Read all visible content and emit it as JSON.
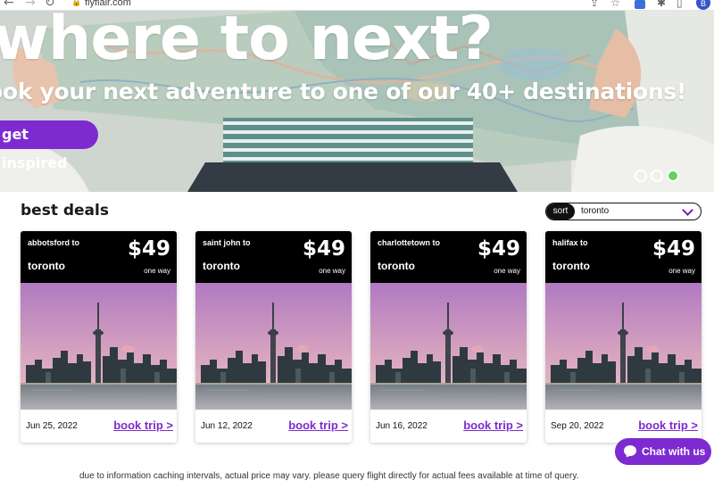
{
  "browser": {
    "url": "flyflair.com"
  },
  "hero": {
    "title": "where to next?",
    "subtitle": "ook your next adventure to one of our 40+ destinations!",
    "cta_label": "get inspired",
    "slides": [
      false,
      false,
      true
    ]
  },
  "deals": {
    "title": "best deals",
    "sort_label": "sort",
    "sort_value": "toronto",
    "cards": [
      {
        "from": "abbotsford to",
        "to": "toronto",
        "price": "$49",
        "type": "one way",
        "date": "Jun 25, 2022",
        "book": "book trip >"
      },
      {
        "from": "saint john to",
        "to": "toronto",
        "price": "$49",
        "type": "one way",
        "date": "Jun 12, 2022",
        "book": "book trip >"
      },
      {
        "from": "charlottetown to",
        "to": "toronto",
        "price": "$49",
        "type": "one way",
        "date": "Jun 16, 2022",
        "book": "book trip >"
      },
      {
        "from": "halifax to",
        "to": "toronto",
        "price": "$49",
        "type": "one way",
        "date": "Sep 20, 2022",
        "book": "book trip >"
      }
    ]
  },
  "chat": {
    "label": "Chat with us"
  },
  "disclaimer": "due to information caching intervals, actual price may vary. please query flight directly for actual fees available at time of query.",
  "colors": {
    "brand_purple": "#7d2bd0",
    "active_dot": "#63d45a"
  }
}
